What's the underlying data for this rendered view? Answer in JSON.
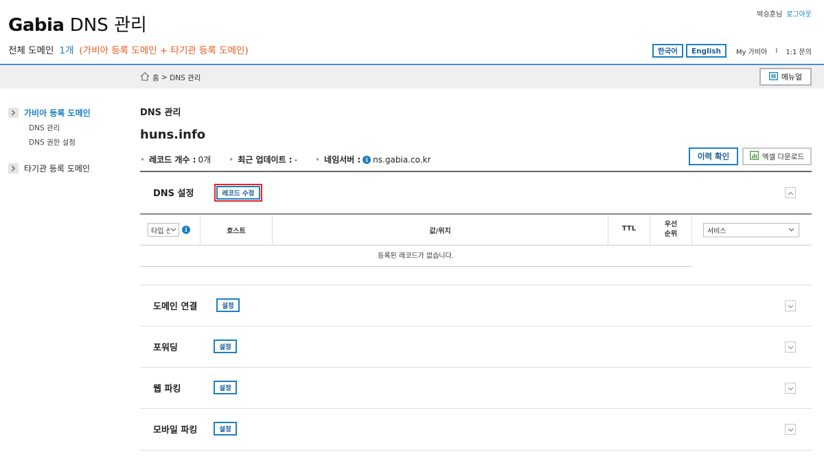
{
  "header": {
    "logo_brand": "Gabia",
    "logo_rest": "DNS 관리",
    "summary_label": "전체 도메인",
    "summary_count": "1개",
    "summary_detail": "(가비아 등록 도메인 + 타기관 등록 도메인)",
    "user_name": "박승훈님",
    "logout": "로그아웃",
    "lang_ko": "한국어",
    "lang_en": "English",
    "my_gabia": "My 가비아",
    "separator": "I",
    "inquiry": "1:1 문의"
  },
  "breadcrumb": {
    "home": "홈",
    "sep": ">",
    "current": "DNS 관리"
  },
  "manual_button": "메뉴얼",
  "sidebar": {
    "group1": "가비아 등록 도메인",
    "sub1": "DNS 관리",
    "sub2": "DNS 권한 설정",
    "group2": "타기관 등록 도메인"
  },
  "main": {
    "page_title": "DNS 관리",
    "domain": "huns.info",
    "record_count_label": "레코드 개수 :",
    "record_count_value": "0개",
    "last_update_label": "최근 업데이트 :",
    "last_update_value": "-",
    "nameserver_label": "네임서버 :",
    "nameserver_value": "ns.gabia.co.kr",
    "history_button": "이력 확인",
    "excel_button": "엑셀 다운로드"
  },
  "dns_section": {
    "title": "DNS 설정",
    "edit_button": "레코드 수정",
    "columns": {
      "type_select": "타입 선택",
      "host": "호스트",
      "value": "값/위치",
      "ttl": "TTL",
      "priority_line1": "우선",
      "priority_line2": "순위",
      "service_select": "서비스"
    },
    "empty_message": "등록된 레코드가 없습니다."
  },
  "sections": [
    {
      "title": "도메인 연결",
      "button": "설정"
    },
    {
      "title": "포워딩",
      "button": "설정"
    },
    {
      "title": "웹 파킹",
      "button": "설정"
    },
    {
      "title": "모바일 파킹",
      "button": "설정"
    }
  ]
}
